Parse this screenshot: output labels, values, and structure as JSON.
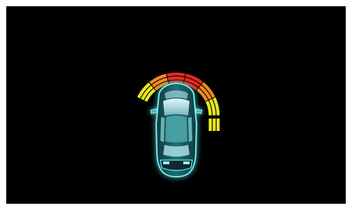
{
  "screen": {
    "background": "#000000",
    "frame_color": "#ffffff"
  },
  "vehicle": {
    "icon": "car-top-view-icon",
    "glow_color": "#5fe3e6"
  },
  "parking_sensor": {
    "active_zone": "front",
    "colors": {
      "far": "#e6e61e",
      "mid": "#f08a1e",
      "near": "#e8281e"
    },
    "segments": [
      {
        "id": "front-left-outer",
        "level": "far",
        "bars": 3
      },
      {
        "id": "front-left-mid",
        "level": "mid",
        "bars": 3
      },
      {
        "id": "front-center",
        "level": "near",
        "bars": 3
      },
      {
        "id": "front-right-mid",
        "level": "near",
        "bars": 3
      },
      {
        "id": "front-right-corner",
        "level": "mid",
        "bars": 3
      },
      {
        "id": "right-side-front",
        "level": "far",
        "bars": 3
      }
    ]
  }
}
